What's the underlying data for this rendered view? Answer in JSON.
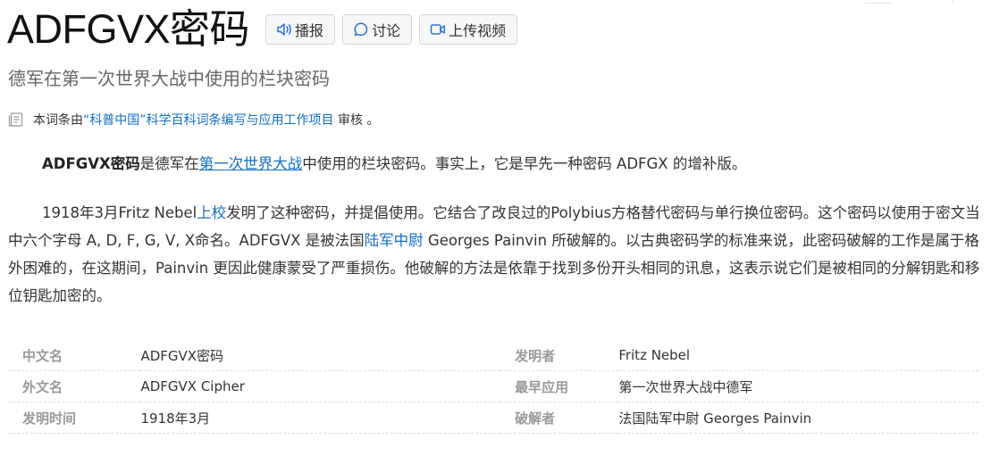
{
  "header": {
    "title": "ADFGVX密码",
    "buttons": {
      "broadcast": "播报",
      "discuss": "讨论",
      "upload_video": "上传视频"
    }
  },
  "subtitle": "德军在第一次世界大战中使用的栏块密码",
  "review": {
    "prefix": "本词条由",
    "link": "“科普中国”科学百科词条编写与应用工作项目",
    "suffix": " 审核 。"
  },
  "paragraph1": {
    "bold": "ADFGVX密码",
    "t1": "是德军在",
    "link": "第一次世界大战",
    "t2": "中使用的栏块密码。事实上，它是早先一种密码 ADFGX 的增补版。"
  },
  "paragraph2": {
    "t1": "1918年3月Fritz Nebel",
    "link1": "上校",
    "t2": "发明了这种密码，并提倡使用。它结合了改良过的Polybius方格替代密码与单行换位密码。这个密码以使用于密文当中六个字母 A, D, F, G, V, X命名。ADFGVX 是被法国",
    "link2": "陆军中尉",
    "t3": " Georges Painvin 所破解的。以古典密码学的标准来说，此密码破解的工作是属于格外困难的，在这期间，Painvin 更因此健康蒙受了严重损伤。他破解的方法是依靠于找到多份开头相同的讯息，这表示说它们是被相同的分解钥匙和移位钥匙加密的。"
  },
  "infobox": {
    "rows": [
      {
        "label1": "中文名",
        "value1": "ADFGVX密码",
        "label2": "发明者",
        "value2": "Fritz Nebel"
      },
      {
        "label1": "外文名",
        "value1": "ADFGVX Cipher",
        "label2": "最早应用",
        "value2": "第一次世界大战中德军"
      },
      {
        "label1": "发明时间",
        "value1": "1918年3月",
        "label2": "破解者",
        "value2": "法国陆军中尉 Georges Painvin"
      }
    ]
  },
  "colors": {
    "link": "#136ec2",
    "label": "#999999",
    "text": "#333333",
    "subtitle": "#666666"
  },
  "icons": [
    "speaker-icon",
    "chat-bubble-icon",
    "video-camera-icon",
    "document-icon"
  ]
}
